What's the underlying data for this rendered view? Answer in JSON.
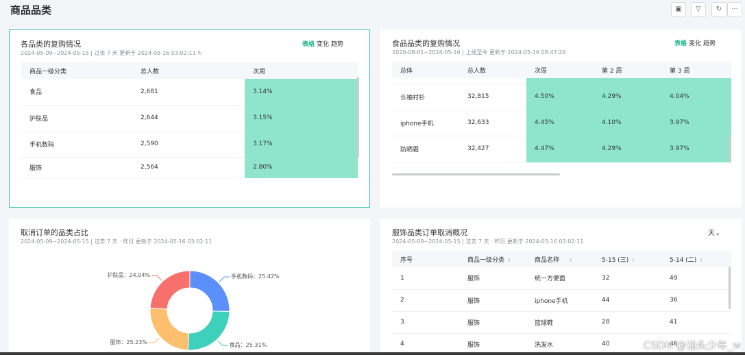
{
  "page": {
    "title": "商品品类",
    "header_buttons": [
      {
        "icon": "save-icon",
        "glyph": "▣"
      },
      {
        "icon": "filter-icon",
        "glyph": "▽"
      },
      {
        "icon": "refresh-icon",
        "glyph": "↻"
      },
      {
        "icon": "more-icon",
        "glyph": "···"
      }
    ]
  },
  "card1": {
    "title": "各品类的复购情况",
    "subtitle": "2024-05-09~2024-05-15 | 过去 7 天 更新于 2024-05-16 03:02:11",
    "refresh_glyph": "↻",
    "views": [
      "表格",
      "变化",
      "趋势"
    ],
    "columns": [
      "商品一级分类",
      "总人数",
      "次周"
    ],
    "rows": [
      [
        "食品",
        "2,681",
        "3.14%"
      ],
      [
        "护肤品",
        "2,644",
        "3.15%"
      ],
      [
        "手机数码",
        "2,590",
        "3.17%"
      ],
      [
        "服饰",
        "2,564",
        "2.80%"
      ]
    ]
  },
  "card2": {
    "title": "食品品类的复购情况",
    "subtitle": "2020-08-01~2024-05-16 | 上线至今 更新于 2024-05-16 08:47:26",
    "views": [
      "表格",
      "变化",
      "趋势"
    ],
    "columns": [
      "总体",
      "总人数",
      "次周",
      "第 2 周",
      "第 3 周"
    ],
    "rows": [
      [
        "长袖衬衫",
        "32,815",
        "4.50%",
        "4.29%",
        "4.04%"
      ],
      [
        "iphone手机",
        "32,633",
        "4.45%",
        "4.10%",
        "3.97%"
      ],
      [
        "防晒霜",
        "32,427",
        "4.47%",
        "4.29%",
        "3.97%"
      ]
    ]
  },
  "card3": {
    "title": "取消订单的品类占比",
    "subtitle": "2024-05-09~2024-05-15 | 过去 7 天 · 昨日 更新于 2024-05-16 03:02:11"
  },
  "chart_data": {
    "type": "pie",
    "donut": true,
    "categories": [
      "手机数码",
      "食品",
      "服饰",
      "护肤品"
    ],
    "values": [
      25.42,
      25.31,
      25.23,
      24.04
    ],
    "labels": [
      "手机数码：25.42%",
      "食品：25.31%",
      "服饰：25.23%",
      "护肤品：24.04%"
    ],
    "colors": [
      "#5b8ff9",
      "#3dd0bb",
      "#fbbf6d",
      "#f8706b"
    ]
  },
  "card4": {
    "title": "服饰品类订单取消概况",
    "subtitle": "2024-05-09~2024-05-15 | 过去 7 天 · 昨日 更新于 2024-05-16 03:02:11",
    "unit_select": "天",
    "sort_glyph": "⇕",
    "columns": [
      "序号",
      "商品一级分类",
      "商品名称",
      "5-15 (三)",
      "5-14 (二)"
    ],
    "rows": [
      [
        "1",
        "服饰",
        "统一方便面",
        "32",
        "49"
      ],
      [
        "2",
        "服饰",
        "iphone手机",
        "44",
        "36"
      ],
      [
        "3",
        "服饰",
        "篮球鞋",
        "28",
        "41"
      ],
      [
        "4",
        "服饰",
        "洗发水",
        "40",
        "46"
      ]
    ]
  },
  "watermark": "CSDN @油头少年_w"
}
